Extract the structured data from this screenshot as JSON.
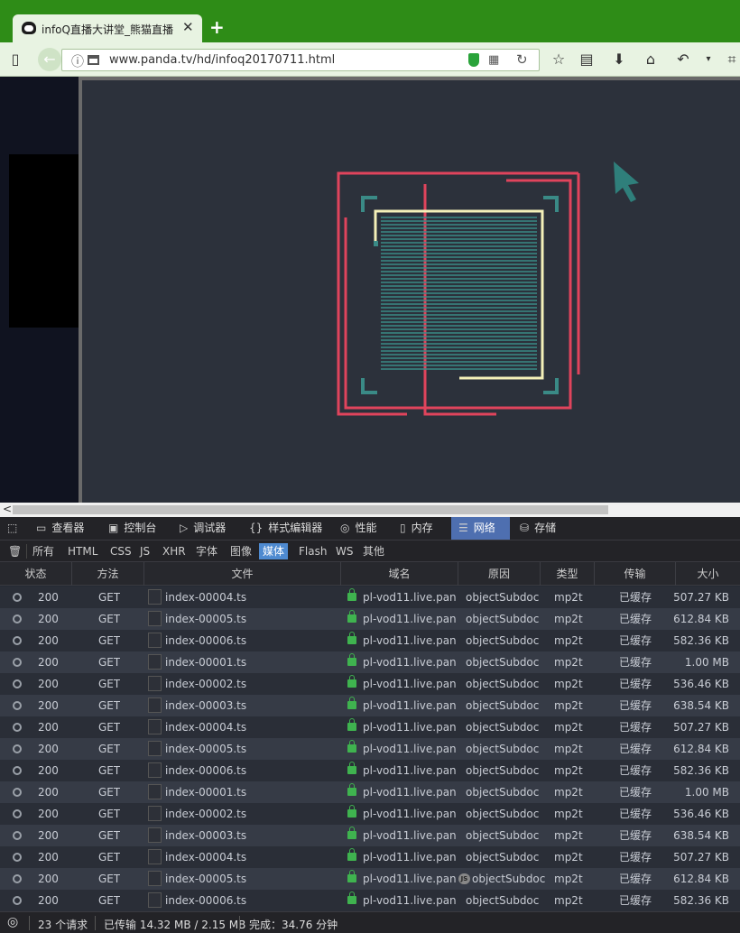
{
  "browser": {
    "tab_title": "infoQ直播大讲堂_熊猫直播",
    "url": "www.panda.tv/hd/infoq20170711.html"
  },
  "devtools": {
    "tabs": [
      {
        "label": "查看器",
        "icon": "inspector-icon"
      },
      {
        "label": "控制台",
        "icon": "console-icon"
      },
      {
        "label": "调试器",
        "icon": "debugger-icon"
      },
      {
        "label": "样式编辑器",
        "icon": "style-editor-icon"
      },
      {
        "label": "性能",
        "icon": "performance-icon"
      },
      {
        "label": "内存",
        "icon": "memory-icon"
      },
      {
        "label": "网络",
        "icon": "network-icon"
      },
      {
        "label": "存储",
        "icon": "storage-icon"
      }
    ],
    "active_tab": "网络",
    "filters": [
      "所有",
      "HTML",
      "CSS",
      "JS",
      "XHR",
      "字体",
      "图像",
      "媒体",
      "Flash",
      "WS",
      "其他"
    ],
    "active_filter": "媒体",
    "columns": [
      "状态",
      "方法",
      "文件",
      "域名",
      "原因",
      "类型",
      "传输",
      "大小"
    ],
    "rows": [
      {
        "status": "200",
        "method": "GET",
        "file": "index-00004.ts",
        "domain": "pl-vod11.live.pan...",
        "cause": "objectSubdoc",
        "type": "mp2t",
        "transfer": "已缓存",
        "size": "507.27 KB"
      },
      {
        "status": "200",
        "method": "GET",
        "file": "index-00005.ts",
        "domain": "pl-vod11.live.pan...",
        "cause": "objectSubdoc",
        "type": "mp2t",
        "transfer": "已缓存",
        "size": "612.84 KB"
      },
      {
        "status": "200",
        "method": "GET",
        "file": "index-00006.ts",
        "domain": "pl-vod11.live.pan...",
        "cause": "objectSubdoc",
        "type": "mp2t",
        "transfer": "已缓存",
        "size": "582.36 KB"
      },
      {
        "status": "200",
        "method": "GET",
        "file": "index-00001.ts",
        "domain": "pl-vod11.live.pan...",
        "cause": "objectSubdoc",
        "type": "mp2t",
        "transfer": "已缓存",
        "size": "1.00 MB"
      },
      {
        "status": "200",
        "method": "GET",
        "file": "index-00002.ts",
        "domain": "pl-vod11.live.pan...",
        "cause": "objectSubdoc",
        "type": "mp2t",
        "transfer": "已缓存",
        "size": "536.46 KB"
      },
      {
        "status": "200",
        "method": "GET",
        "file": "index-00003.ts",
        "domain": "pl-vod11.live.pan...",
        "cause": "objectSubdoc",
        "type": "mp2t",
        "transfer": "已缓存",
        "size": "638.54 KB"
      },
      {
        "status": "200",
        "method": "GET",
        "file": "index-00004.ts",
        "domain": "pl-vod11.live.pan...",
        "cause": "objectSubdoc",
        "type": "mp2t",
        "transfer": "已缓存",
        "size": "507.27 KB"
      },
      {
        "status": "200",
        "method": "GET",
        "file": "index-00005.ts",
        "domain": "pl-vod11.live.pan...",
        "cause": "objectSubdoc",
        "type": "mp2t",
        "transfer": "已缓存",
        "size": "612.84 KB"
      },
      {
        "status": "200",
        "method": "GET",
        "file": "index-00006.ts",
        "domain": "pl-vod11.live.pan...",
        "cause": "objectSubdoc",
        "type": "mp2t",
        "transfer": "已缓存",
        "size": "582.36 KB"
      },
      {
        "status": "200",
        "method": "GET",
        "file": "index-00001.ts",
        "domain": "pl-vod11.live.pan...",
        "cause": "objectSubdoc",
        "type": "mp2t",
        "transfer": "已缓存",
        "size": "1.00 MB"
      },
      {
        "status": "200",
        "method": "GET",
        "file": "index-00002.ts",
        "domain": "pl-vod11.live.pan...",
        "cause": "objectSubdoc",
        "type": "mp2t",
        "transfer": "已缓存",
        "size": "536.46 KB"
      },
      {
        "status": "200",
        "method": "GET",
        "file": "index-00003.ts",
        "domain": "pl-vod11.live.pan...",
        "cause": "objectSubdoc",
        "type": "mp2t",
        "transfer": "已缓存",
        "size": "638.54 KB"
      },
      {
        "status": "200",
        "method": "GET",
        "file": "index-00004.ts",
        "domain": "pl-vod11.live.pan...",
        "cause": "objectSubdoc",
        "type": "mp2t",
        "transfer": "已缓存",
        "size": "507.27 KB"
      },
      {
        "status": "200",
        "method": "GET",
        "file": "index-00005.ts",
        "domain": "pl-vod11.live.pan...",
        "cause": "objectSubdoc",
        "type": "mp2t",
        "transfer": "已缓存",
        "size": "612.84 KB",
        "js_badge": true
      },
      {
        "status": "200",
        "method": "GET",
        "file": "index-00006.ts",
        "domain": "pl-vod11.live.pan...",
        "cause": "objectSubdoc",
        "type": "mp2t",
        "transfer": "已缓存",
        "size": "582.36 KB"
      }
    ],
    "footer": {
      "requests": "23 个请求",
      "transferred": "已传输 14.32 MB / 2.15 MB",
      "finish": "完成：34.76 分钟"
    }
  },
  "colors": {
    "chrome_green": "#2e8c17",
    "active_tab": "#4e6fb0",
    "video_bg": "#2c313b",
    "frame_red": "#e0445c",
    "frame_teal": "#3a8a86",
    "frame_cream": "#f4f0b8"
  }
}
